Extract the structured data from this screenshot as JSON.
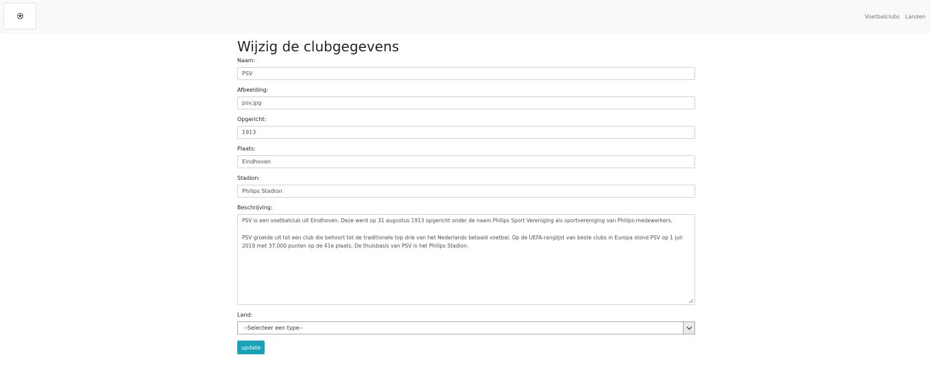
{
  "navbar": {
    "logo_icon": "soccer-ball-icon",
    "links": [
      "Voetbalclubs",
      "Landen"
    ]
  },
  "form": {
    "title": "Wijzig de clubgegevens",
    "naam": {
      "label": "Naam:",
      "value": "PSV"
    },
    "afbeelding": {
      "label": "Afbeelding:",
      "value": "psv.jpg"
    },
    "opgericht": {
      "label": "Opgericht:",
      "value": "1913"
    },
    "plaats": {
      "label": "Plaats:",
      "value": "Eindhoven"
    },
    "stadion": {
      "label": "Stadion:",
      "value": "Philips Stadion"
    },
    "beschrijving": {
      "label": "Beschrijving:",
      "paragraphs": [
        "PSV is een voetbalclub uit Eindhoven. Deze werd op 31 augustus 1913 opgericht onder de naam Philips Sport Vereniging als sportvereniging van Philips-medewerkers.",
        "PSV groeide uit tot een club die behoort tot de traditionele top drie van het Nederlands betaald voetbal. Op de UEFA-ranglijst van beste clubs in Europa stond PSV op 1 juli 2019 met 37.000 punten op de 41e plaats. De thuisbasis van PSV is het Philips Stadion."
      ]
    },
    "land": {
      "label": "Land:",
      "selected": "--Selecteer een type--"
    },
    "submit_label": "update"
  },
  "colors": {
    "accent": "#17a2b8",
    "navbar_bg": "#f8f9fa"
  }
}
